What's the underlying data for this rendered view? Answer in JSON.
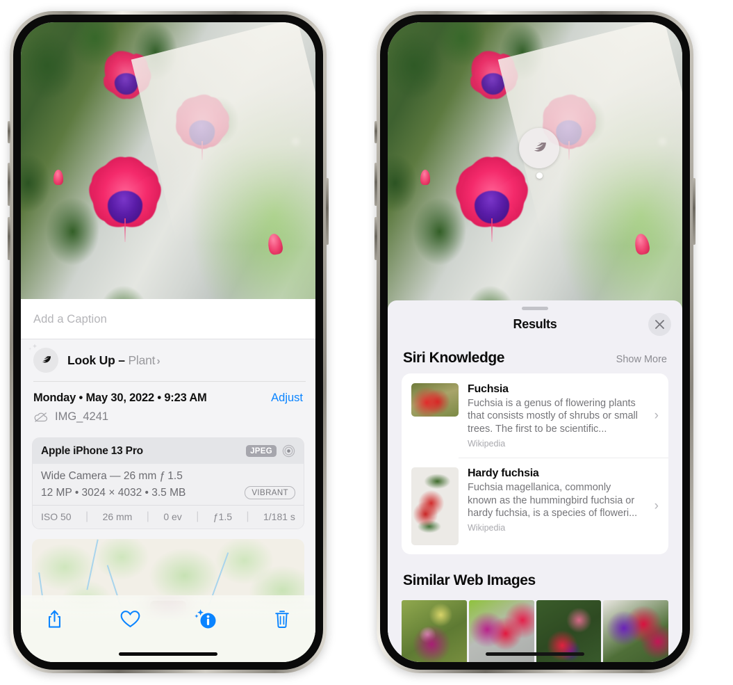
{
  "left_phone": {
    "caption_placeholder": "Add a Caption",
    "lookup": {
      "icon": "leaf-icon",
      "sparkle_icon": "sparkle-icon",
      "label": "Look Up – ",
      "subject": "Plant",
      "chevron": "›"
    },
    "metadata": {
      "date": "Monday • May 30, 2022 • 9:23 AM",
      "adjust_label": "Adjust",
      "cloud_icon": "icloud-slash-icon",
      "filename": "IMG_4241"
    },
    "camera_card": {
      "device": "Apple iPhone 13 Pro",
      "format_badge": "JPEG",
      "lens_icon": "aperture-icon",
      "lens_line": "Wide Camera — 26 mm ƒ 1.5",
      "size_line": "12 MP • 3024 × 4032 • 3.5 MB",
      "style_badge": "VIBRANT",
      "exif": [
        "ISO 50",
        "26 mm",
        "0 ev",
        "ƒ1.5",
        "1/181 s"
      ]
    },
    "map": {
      "pin_icon": "photo-pin"
    },
    "toolbar": [
      {
        "name": "share-button",
        "icon": "share-icon"
      },
      {
        "name": "favorite-button",
        "icon": "heart-icon"
      },
      {
        "name": "info-button",
        "icon": "info-sparkle-icon"
      },
      {
        "name": "delete-button",
        "icon": "trash-icon"
      }
    ]
  },
  "right_phone": {
    "callout": {
      "icon": "leaf-icon"
    },
    "sheet": {
      "title": "Results",
      "close_icon": "close-icon",
      "siri_section": {
        "title": "Siri Knowledge",
        "show_more": "Show More",
        "items": [
          {
            "name": "Fuchsia",
            "description": "Fuchsia is a genus of flowering plants that consists mostly of shrubs or small trees. The first to be scientific...",
            "source": "Wikipedia",
            "chevron": "›",
            "thumb": "fuchsia-thumb"
          },
          {
            "name": "Hardy fuchsia",
            "description": "Fuchsia magellanica, commonly known as the hummingbird fuchsia or hardy fuchsia, is a species of floweri...",
            "source": "Wikipedia",
            "chevron": "›",
            "thumb": "hardy-fuchsia-thumb"
          }
        ]
      },
      "web_section": {
        "title": "Similar Web Images",
        "images": [
          {
            "name": "web-image-1"
          },
          {
            "name": "web-image-2"
          },
          {
            "name": "web-image-3"
          },
          {
            "name": "web-image-4"
          }
        ]
      }
    }
  },
  "colors": {
    "accent_blue": "#0a84ff",
    "sheet_bg": "#f1f0f5",
    "card_bg": "#ffffff",
    "secondary_text": "#8c8c92"
  }
}
